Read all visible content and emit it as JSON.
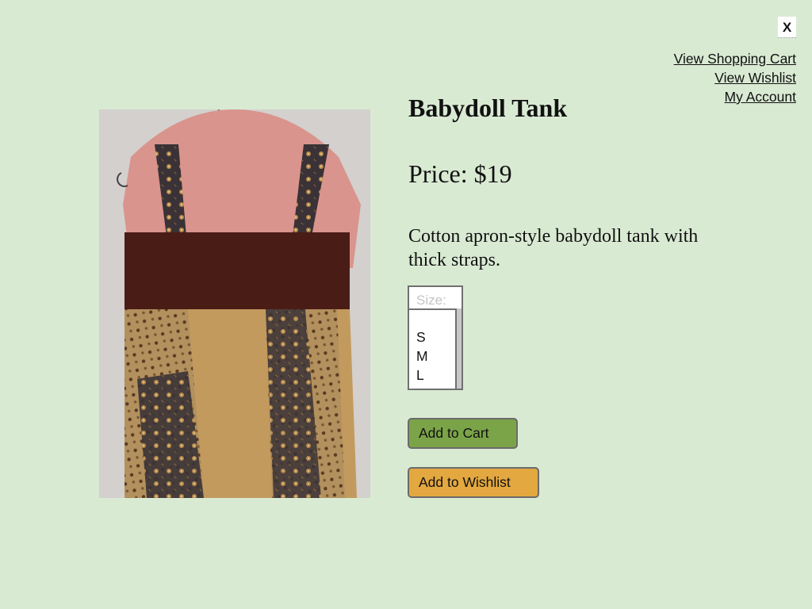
{
  "close_button": {
    "label": "X",
    "icon": "close-icon"
  },
  "account_links": [
    "View Shopping Cart",
    "View Wishlist",
    "My Account"
  ],
  "product": {
    "title": "Babydoll Tank",
    "price_label": "Price: $19",
    "description": "Cotton apron-style babydoll tank with thick straps.",
    "image_description": "photo of brown and gold patchwork babydoll tank on a dress form"
  },
  "size_select": {
    "placeholder": "Size:",
    "options": [
      "S",
      "M",
      "L"
    ]
  },
  "buttons": {
    "add_to_cart": "Add to Cart",
    "add_to_wishlist": "Add to Wishlist"
  },
  "colors": {
    "background": "#d9ead3",
    "add_to_cart": "#7ba448",
    "add_to_wishlist": "#e3a83f"
  }
}
